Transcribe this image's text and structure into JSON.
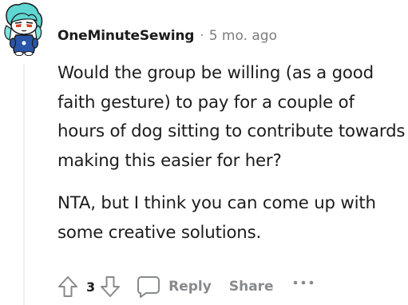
{
  "comment": {
    "author": "OneMinuteSewing",
    "separator": "·",
    "timestamp": "5 mo. ago",
    "paragraphs": [
      "Would the group be willing (as a good faith gesture) to pay for a couple of hours of dog sitting to contribute towards making this easier for her?",
      "NTA, but I think you can come up with some creative solutions."
    ],
    "score": "3",
    "actions": {
      "reply_label": "Reply",
      "share_label": "Share"
    }
  },
  "icons": {
    "upvote": "arrow-up-icon",
    "downvote": "arrow-down-icon",
    "reply": "speech-bubble-icon",
    "more": "ellipsis-icon"
  },
  "colors": {
    "text": "#1c1c1c",
    "meta": "#7c7c7c",
    "action": "#878a8c",
    "avatar_hair": "#5fd6d2",
    "avatar_shirt": "#2a55a8"
  }
}
